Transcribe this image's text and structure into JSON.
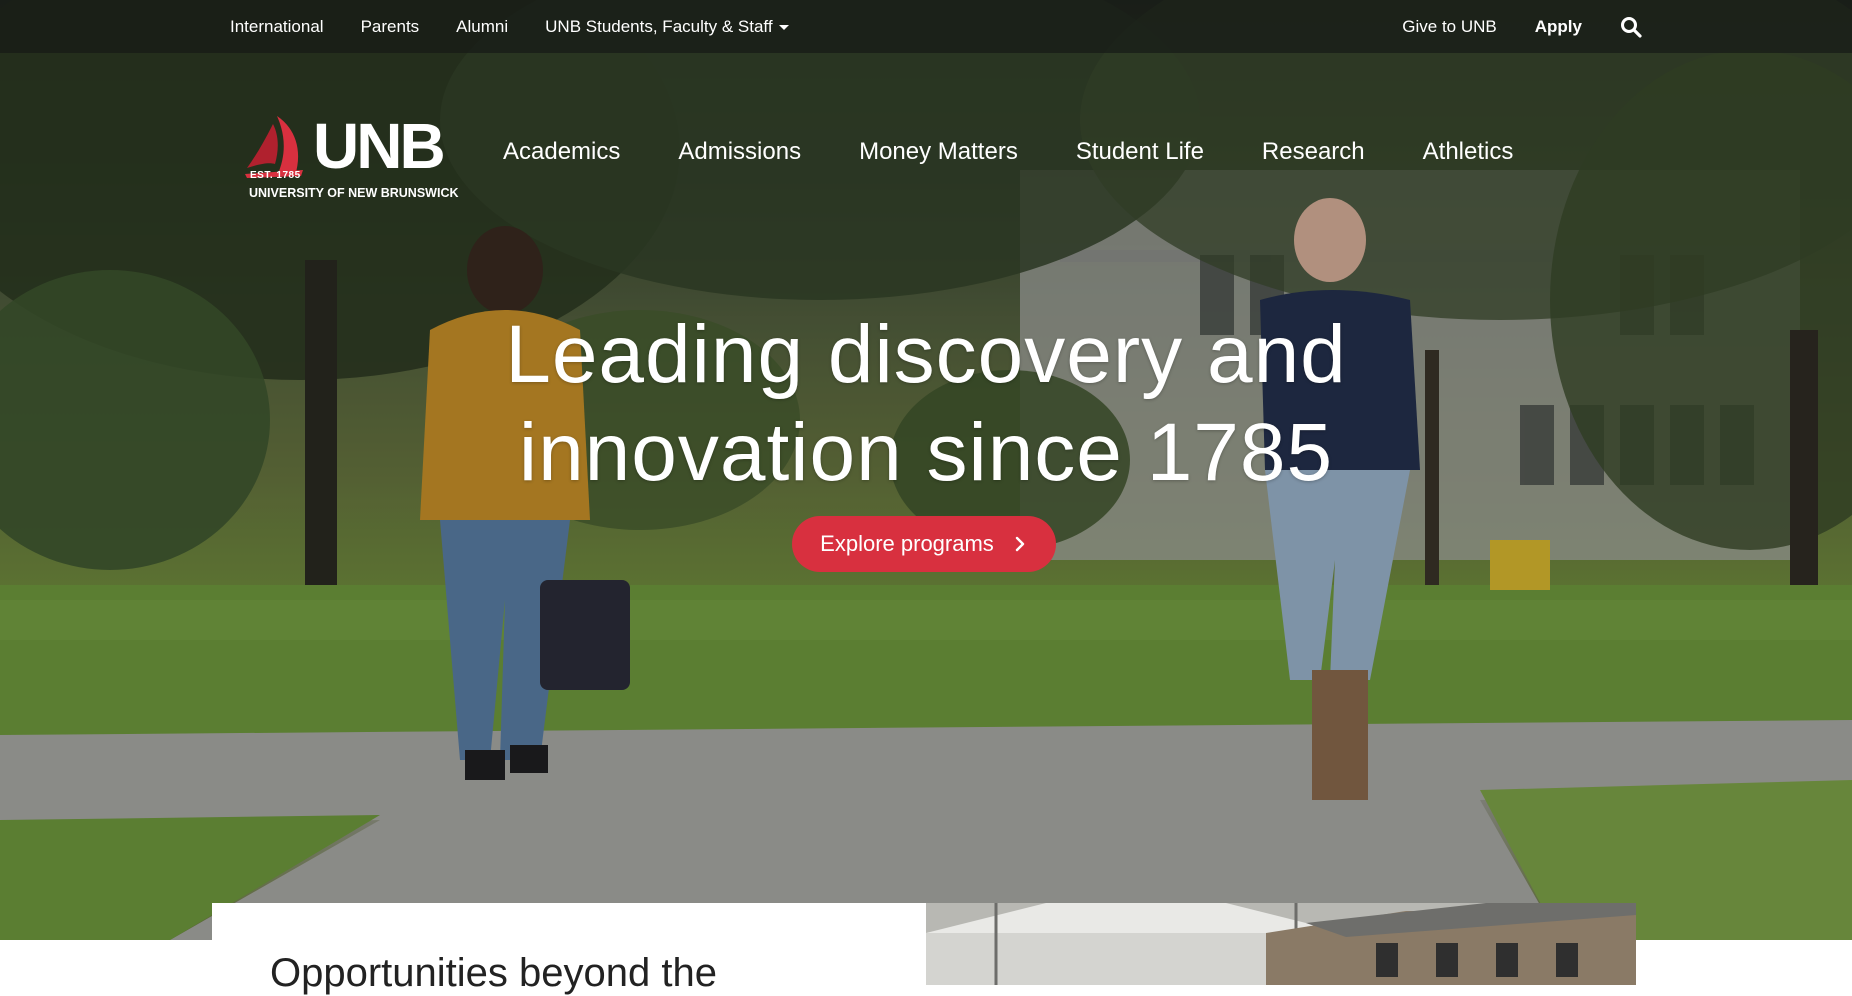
{
  "utility_nav": {
    "left_links": [
      "International",
      "Parents",
      "Alumni",
      "UNB Students, Faculty & Staff"
    ],
    "give_label": "Give to UNB",
    "apply_label": "Apply",
    "search_icon": "search-icon"
  },
  "logo": {
    "wordmark": "UNB",
    "est": "EST. 1785",
    "name": "UNIVERSITY OF NEW BRUNSWICK",
    "accent_color": "#d8303f"
  },
  "main_nav": {
    "items": [
      "Academics",
      "Admissions",
      "Money Matters",
      "Student Life",
      "Research",
      "Athletics"
    ]
  },
  "hero": {
    "title_line1": "Leading discovery and",
    "title_line2": "innovation since 1785",
    "cta_label": "Explore programs",
    "cta_icon": "chevron-right-icon",
    "cta_color": "#d8303f"
  },
  "card": {
    "heading": "Opportunities beyond the"
  }
}
